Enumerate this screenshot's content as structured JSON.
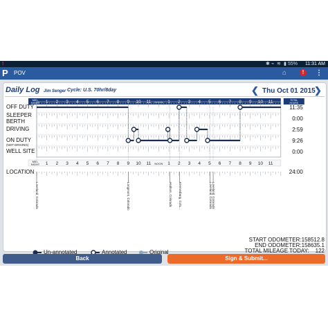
{
  "status_bar": {
    "left_icon": "alert-icon",
    "battery": "55%",
    "time": "11:31 AM"
  },
  "app_bar": {
    "title": "POV",
    "logo_text": "P"
  },
  "header": {
    "title": "Daily Log",
    "driver": "Jim Senger",
    "cycle": "Cycle: U.S. 70hr/8day",
    "date": "Thu Oct 01 2015",
    "prev_icon": "chevron-left-icon",
    "next_icon": "chevron-right-icon"
  },
  "grid": {
    "hours": [
      "MID-\nNIGHT",
      "1",
      "2",
      "3",
      "4",
      "5",
      "6",
      "7",
      "8",
      "9",
      "10",
      "11",
      "NOON",
      "1",
      "2",
      "3",
      "4",
      "5",
      "6",
      "7",
      "8",
      "9",
      "10",
      "11"
    ],
    "total_hours_label": "TOTAL HOURS",
    "rows": [
      {
        "label": "OFF DUTY",
        "sublabel": "",
        "total": "11:35"
      },
      {
        "label": "SLEEPER BERTH",
        "sublabel": "",
        "total": "0:00"
      },
      {
        "label": "DRIVING",
        "sublabel": "",
        "total": "2:59"
      },
      {
        "label": "ON DUTY",
        "sublabel": "(NOT DRIVING)",
        "total": "9:26"
      },
      {
        "label": "WELL SITE",
        "sublabel": "",
        "total": "0:00"
      }
    ],
    "location_label": "LOCATION",
    "location_total": "24:00",
    "locations": [
      {
        "text": "Loveland, Colorado",
        "hour": 0
      },
      {
        "text": "Longmont, Colorado",
        "hour": 9
      },
      {
        "text": "Hudson, Colorado",
        "hour": 13.1
      },
      {
        "text": "Keenesburg, Colo...",
        "hour": 14.05
      },
      {
        "text": "Loveland, Colorado",
        "hour": 17.05
      },
      {
        "text": "Loveland, Colorado",
        "hour": 17.35
      }
    ]
  },
  "legend": {
    "un_annotated": "Un-annotated",
    "annotated": "Annotated",
    "original": "Original"
  },
  "odometer": {
    "start_label": "START ODOMETER:",
    "start_value": "158512.8",
    "end_label": "END ODOMETER:",
    "end_value": "158635.1",
    "mileage_label": "TOTAL MILEAGE TODAY:",
    "mileage_value": "122"
  },
  "buttons": {
    "back": "Back",
    "submit": "Sign & Submit..."
  },
  "log_segments": [
    {
      "row": 0,
      "start": 0,
      "end": 9.0
    },
    {
      "row": 3,
      "start": 9.0,
      "end": 9.55
    },
    {
      "row": 2,
      "start": 9.55,
      "end": 10.0
    },
    {
      "row": 3,
      "start": 10.0,
      "end": 12.9
    },
    {
      "row": 2,
      "start": 12.9,
      "end": 13.1
    },
    {
      "row": 3,
      "start": 13.1,
      "end": 14.0
    },
    {
      "row": 0,
      "start": 14.0,
      "end": 14.75
    },
    {
      "row": 3,
      "start": 14.75,
      "end": 15.75
    },
    {
      "row": 2,
      "start": 15.75,
      "end": 16.8
    },
    {
      "row": 3,
      "start": 16.8,
      "end": 20.0
    },
    {
      "row": 0,
      "start": 20.0,
      "end": 24.0
    }
  ],
  "colors": {
    "grid_header": "#1c3c78",
    "line": "#1c2d4e",
    "annotated_dot": "#2a5aa0"
  }
}
